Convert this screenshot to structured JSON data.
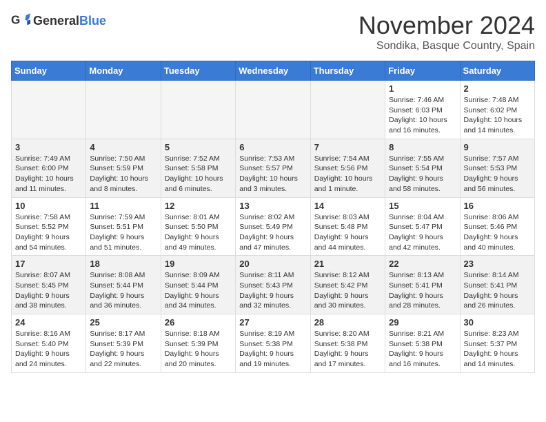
{
  "header": {
    "logo_general": "General",
    "logo_blue": "Blue",
    "title": "November 2024",
    "location": "Sondika, Basque Country, Spain"
  },
  "weekdays": [
    "Sunday",
    "Monday",
    "Tuesday",
    "Wednesday",
    "Thursday",
    "Friday",
    "Saturday"
  ],
  "weeks": [
    [
      {
        "day": "",
        "info": ""
      },
      {
        "day": "",
        "info": ""
      },
      {
        "day": "",
        "info": ""
      },
      {
        "day": "",
        "info": ""
      },
      {
        "day": "",
        "info": ""
      },
      {
        "day": "1",
        "info": "Sunrise: 7:46 AM\nSunset: 6:03 PM\nDaylight: 10 hours and 16 minutes."
      },
      {
        "day": "2",
        "info": "Sunrise: 7:48 AM\nSunset: 6:02 PM\nDaylight: 10 hours and 14 minutes."
      }
    ],
    [
      {
        "day": "3",
        "info": "Sunrise: 7:49 AM\nSunset: 6:00 PM\nDaylight: 10 hours and 11 minutes."
      },
      {
        "day": "4",
        "info": "Sunrise: 7:50 AM\nSunset: 5:59 PM\nDaylight: 10 hours and 8 minutes."
      },
      {
        "day": "5",
        "info": "Sunrise: 7:52 AM\nSunset: 5:58 PM\nDaylight: 10 hours and 6 minutes."
      },
      {
        "day": "6",
        "info": "Sunrise: 7:53 AM\nSunset: 5:57 PM\nDaylight: 10 hours and 3 minutes."
      },
      {
        "day": "7",
        "info": "Sunrise: 7:54 AM\nSunset: 5:56 PM\nDaylight: 10 hours and 1 minute."
      },
      {
        "day": "8",
        "info": "Sunrise: 7:55 AM\nSunset: 5:54 PM\nDaylight: 9 hours and 58 minutes."
      },
      {
        "day": "9",
        "info": "Sunrise: 7:57 AM\nSunset: 5:53 PM\nDaylight: 9 hours and 56 minutes."
      }
    ],
    [
      {
        "day": "10",
        "info": "Sunrise: 7:58 AM\nSunset: 5:52 PM\nDaylight: 9 hours and 54 minutes."
      },
      {
        "day": "11",
        "info": "Sunrise: 7:59 AM\nSunset: 5:51 PM\nDaylight: 9 hours and 51 minutes."
      },
      {
        "day": "12",
        "info": "Sunrise: 8:01 AM\nSunset: 5:50 PM\nDaylight: 9 hours and 49 minutes."
      },
      {
        "day": "13",
        "info": "Sunrise: 8:02 AM\nSunset: 5:49 PM\nDaylight: 9 hours and 47 minutes."
      },
      {
        "day": "14",
        "info": "Sunrise: 8:03 AM\nSunset: 5:48 PM\nDaylight: 9 hours and 44 minutes."
      },
      {
        "day": "15",
        "info": "Sunrise: 8:04 AM\nSunset: 5:47 PM\nDaylight: 9 hours and 42 minutes."
      },
      {
        "day": "16",
        "info": "Sunrise: 8:06 AM\nSunset: 5:46 PM\nDaylight: 9 hours and 40 minutes."
      }
    ],
    [
      {
        "day": "17",
        "info": "Sunrise: 8:07 AM\nSunset: 5:45 PM\nDaylight: 9 hours and 38 minutes."
      },
      {
        "day": "18",
        "info": "Sunrise: 8:08 AM\nSunset: 5:44 PM\nDaylight: 9 hours and 36 minutes."
      },
      {
        "day": "19",
        "info": "Sunrise: 8:09 AM\nSunset: 5:44 PM\nDaylight: 9 hours and 34 minutes."
      },
      {
        "day": "20",
        "info": "Sunrise: 8:11 AM\nSunset: 5:43 PM\nDaylight: 9 hours and 32 minutes."
      },
      {
        "day": "21",
        "info": "Sunrise: 8:12 AM\nSunset: 5:42 PM\nDaylight: 9 hours and 30 minutes."
      },
      {
        "day": "22",
        "info": "Sunrise: 8:13 AM\nSunset: 5:41 PM\nDaylight: 9 hours and 28 minutes."
      },
      {
        "day": "23",
        "info": "Sunrise: 8:14 AM\nSunset: 5:41 PM\nDaylight: 9 hours and 26 minutes."
      }
    ],
    [
      {
        "day": "24",
        "info": "Sunrise: 8:16 AM\nSunset: 5:40 PM\nDaylight: 9 hours and 24 minutes."
      },
      {
        "day": "25",
        "info": "Sunrise: 8:17 AM\nSunset: 5:39 PM\nDaylight: 9 hours and 22 minutes."
      },
      {
        "day": "26",
        "info": "Sunrise: 8:18 AM\nSunset: 5:39 PM\nDaylight: 9 hours and 20 minutes."
      },
      {
        "day": "27",
        "info": "Sunrise: 8:19 AM\nSunset: 5:38 PM\nDaylight: 9 hours and 19 minutes."
      },
      {
        "day": "28",
        "info": "Sunrise: 8:20 AM\nSunset: 5:38 PM\nDaylight: 9 hours and 17 minutes."
      },
      {
        "day": "29",
        "info": "Sunrise: 8:21 AM\nSunset: 5:38 PM\nDaylight: 9 hours and 16 minutes."
      },
      {
        "day": "30",
        "info": "Sunrise: 8:23 AM\nSunset: 5:37 PM\nDaylight: 9 hours and 14 minutes."
      }
    ]
  ]
}
